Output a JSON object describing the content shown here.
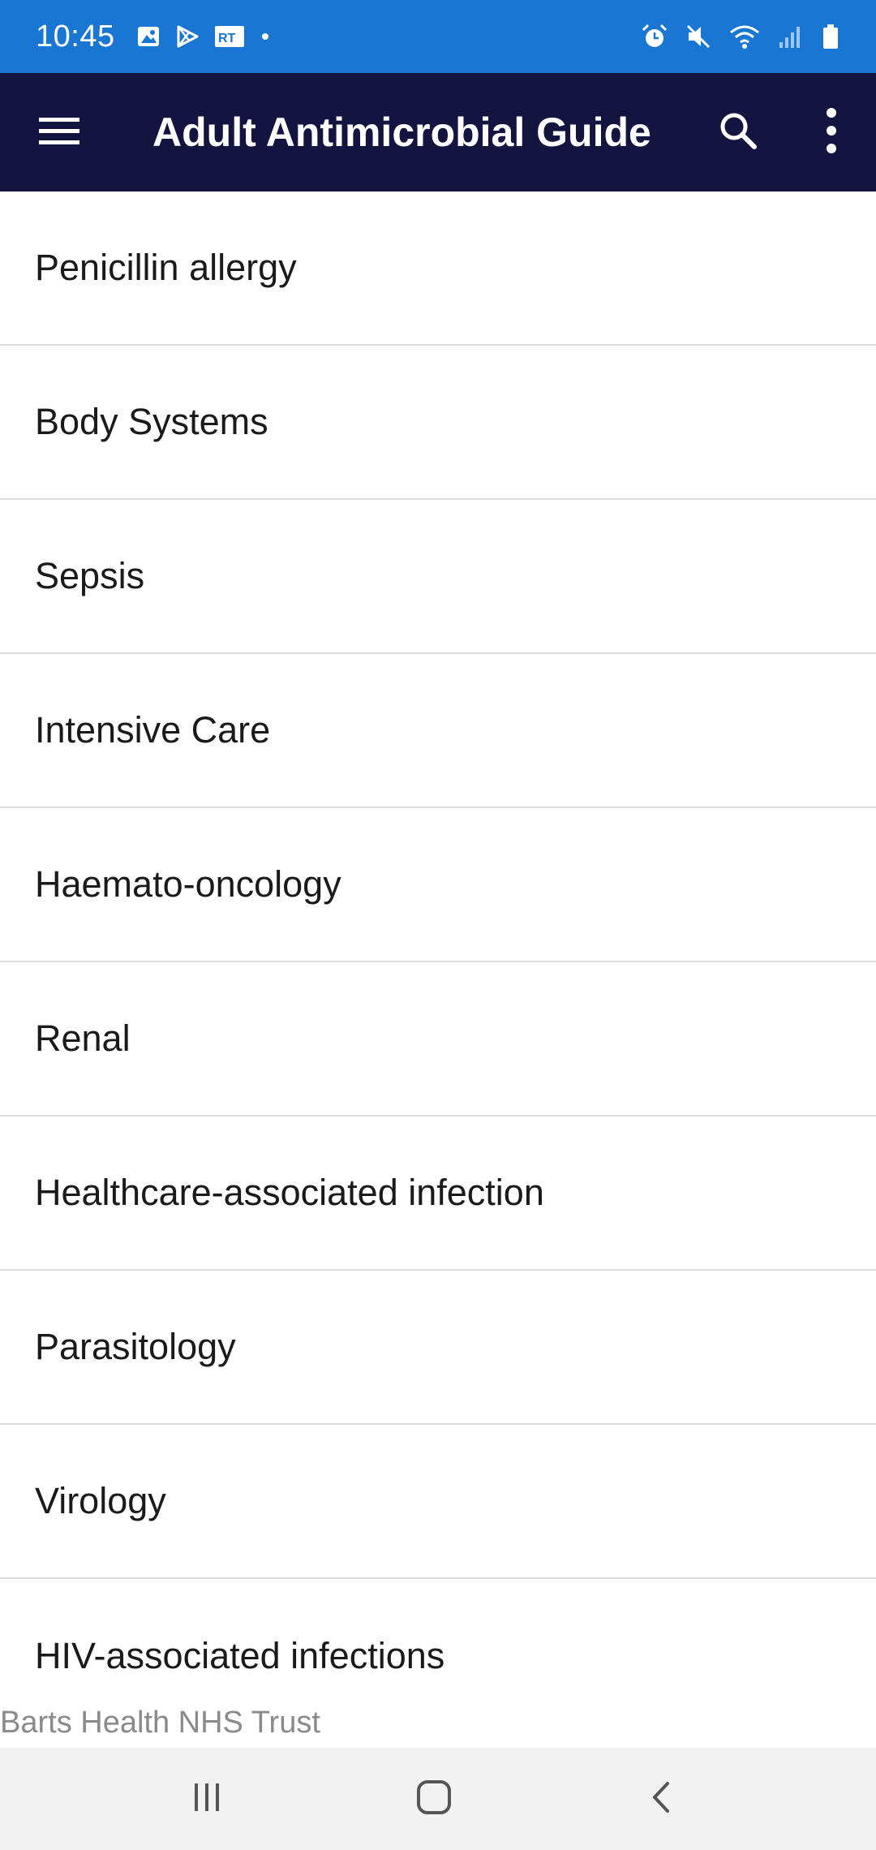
{
  "status_bar": {
    "time": "10:45",
    "left_icons": [
      "image-icon",
      "play-store-icon",
      "rt-news-icon",
      "dot-icon"
    ],
    "right_icons": [
      "alarm-icon",
      "mute-icon",
      "wifi-icon",
      "signal-icon",
      "battery-icon"
    ]
  },
  "app_bar": {
    "title": "Adult Antimicrobial Guide",
    "menu_icon": "menu-icon",
    "search_icon": "search-icon",
    "more_icon": "more-vert-icon"
  },
  "list": {
    "items": [
      {
        "label": "Penicillin allergy"
      },
      {
        "label": "Body Systems"
      },
      {
        "label": "Sepsis"
      },
      {
        "label": "Intensive Care"
      },
      {
        "label": "Haemato-oncology"
      },
      {
        "label": "Renal"
      },
      {
        "label": "Healthcare-associated infection"
      },
      {
        "label": "Parasitology"
      },
      {
        "label": "Virology"
      },
      {
        "label": "HIV-associated infections"
      }
    ]
  },
  "footer": {
    "text": "Barts Health NHS Trust"
  },
  "nav_bar": {
    "recents_icon": "recents-icon",
    "home_icon": "home-icon",
    "back_icon": "back-icon"
  },
  "colors": {
    "status_bar": "#1976d2",
    "app_bar": "#141440",
    "divider": "#dcdcdc",
    "nav_bar": "#f2f2f2"
  }
}
